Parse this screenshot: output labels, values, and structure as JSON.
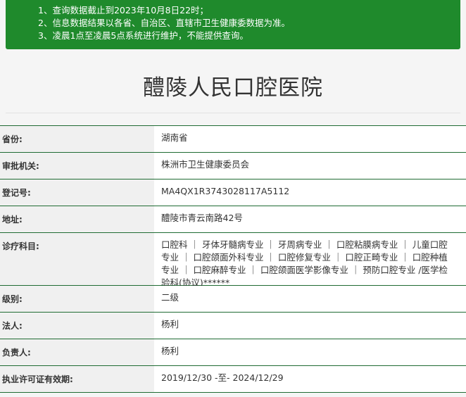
{
  "notice": {
    "lines": [
      "1、查询数据截止到2023年10月8日22时；",
      "2、信息数据结果以各省、自治区、直辖市卫生健康委数据为准。",
      "3、凌晨1点至凌晨5点系统进行维护，不能提供查询。"
    ]
  },
  "hospital": {
    "name": "醴陵人民口腔医院"
  },
  "info": {
    "rows": [
      {
        "label": "省份:",
        "value": "湖南省"
      },
      {
        "label": "审批机关:",
        "value": "株洲市卫生健康委员会"
      },
      {
        "label": "登记号:",
        "value": "MA4QX1R3743028117A5112"
      },
      {
        "label": "地址:",
        "value": "醴陵市青云南路42号"
      },
      {
        "label": "诊疗科目:",
        "value": "口腔科 ｜ 牙体牙髓病专业 ｜ 牙周病专业 ｜ 口腔粘膜病专业 ｜ 儿童口腔专业 ｜ 口腔颌面外科专业 ｜ 口腔修复专业 ｜ 口腔正畸专业 ｜ 口腔种植专业 ｜ 口腔麻醉专业 ｜ 口腔颌面医学影像专业 ｜ 预防口腔专业 /医学检验科(协议)******"
      },
      {
        "label": "级别:",
        "value": "二级"
      },
      {
        "label": "法人:",
        "value": "杨利"
      },
      {
        "label": "负责人:",
        "value": "杨利"
      },
      {
        "label": "执业许可证有效期:",
        "value": "2019/12/30 -至- 2024/12/29"
      }
    ]
  },
  "colors": {
    "notice_bg": "#1f8a2c",
    "row_border": "#1f6b33"
  }
}
